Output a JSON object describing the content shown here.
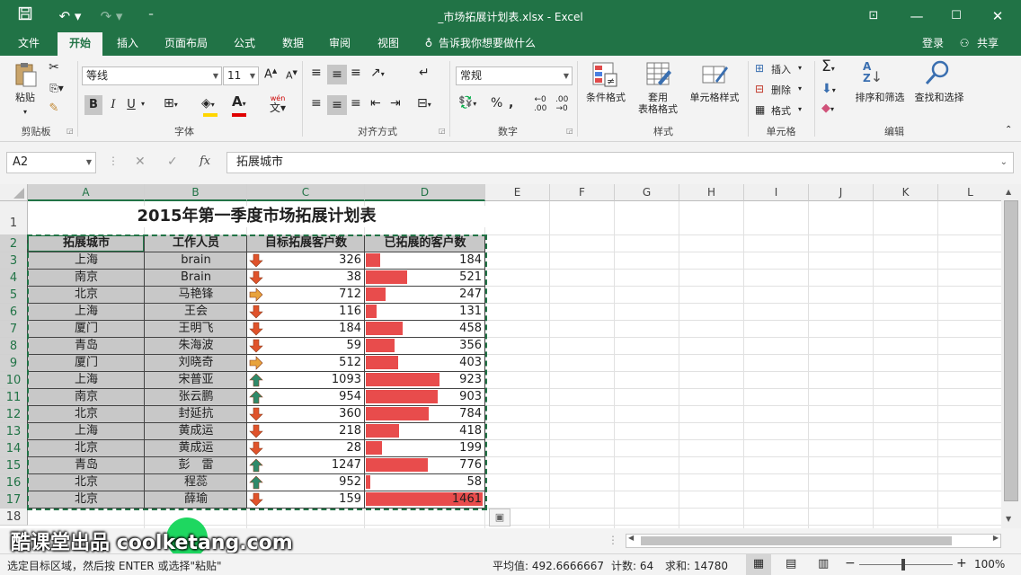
{
  "window": {
    "title": "_市场拓展计划表.xlsx - Excel"
  },
  "quick_access": {
    "save_icon": "save-icon",
    "undo_icon": "undo-icon",
    "redo_icon": "redo-icon",
    "customize_icon": "customize-icon"
  },
  "tabs": [
    "文件",
    "开始",
    "插入",
    "页面布局",
    "公式",
    "数据",
    "审阅",
    "视图"
  ],
  "tell_me": "告诉我你想要做什么",
  "login": "登录",
  "share": "共享",
  "ribbon": {
    "paste": "粘贴",
    "clipboard": "剪贴板",
    "font_name": "等线",
    "font_size": "11",
    "font_group": "字体",
    "align_group": "对齐方式",
    "number_format": "常规",
    "number_group": "数字",
    "cond_format": "条件格式",
    "table_format": "套用\n表格格式",
    "cell_style": "单元格样式",
    "style_group": "样式",
    "insert": "插入",
    "delete": "删除",
    "format": "格式",
    "cells_group": "单元格",
    "sort_filter": "排序和筛选",
    "find_select": "查找和选择",
    "edit_group": "编辑",
    "bold": "B",
    "italic": "I",
    "underline": "U",
    "wen": "wén"
  },
  "formula_bar": {
    "name_box": "A2",
    "fx": "fx",
    "content": "拓展城市"
  },
  "sheet": {
    "columns": [
      "A",
      "B",
      "C",
      "D",
      "E",
      "F",
      "G",
      "H",
      "I",
      "J",
      "K",
      "L"
    ],
    "rows": [
      "1",
      "2",
      "3",
      "4",
      "5",
      "6",
      "7",
      "8",
      "9",
      "10",
      "11",
      "12",
      "13",
      "14",
      "15",
      "16",
      "17",
      "18"
    ],
    "title": "2015年第一季度市场拓展计划表",
    "headers": [
      "拓展城市",
      "工作人员",
      "目标拓展客户数",
      "已拓展的客户数"
    ],
    "data": [
      {
        "city": "上海",
        "staff": "brain",
        "target": 326,
        "done": 184,
        "arrow": "down"
      },
      {
        "city": "南京",
        "staff": "Brain",
        "target": 38,
        "done": 521,
        "arrow": "down"
      },
      {
        "city": "北京",
        "staff": "马艳锋",
        "target": 712,
        "done": 247,
        "arrow": "right"
      },
      {
        "city": "上海",
        "staff": "王会",
        "target": 116,
        "done": 131,
        "arrow": "down"
      },
      {
        "city": "厦门",
        "staff": "王明飞",
        "target": 184,
        "done": 458,
        "arrow": "down"
      },
      {
        "city": "青岛",
        "staff": "朱海波",
        "target": 59,
        "done": 356,
        "arrow": "down"
      },
      {
        "city": "厦门",
        "staff": "刘晓奇",
        "target": 512,
        "done": 403,
        "arrow": "right"
      },
      {
        "city": "上海",
        "staff": "宋普亚",
        "target": 1093,
        "done": 923,
        "arrow": "up"
      },
      {
        "city": "南京",
        "staff": "张云鹏",
        "target": 954,
        "done": 903,
        "arrow": "up"
      },
      {
        "city": "北京",
        "staff": "封延抗",
        "target": 360,
        "done": 784,
        "arrow": "down"
      },
      {
        "city": "上海",
        "staff": "黄成运",
        "target": 218,
        "done": 418,
        "arrow": "down"
      },
      {
        "city": "北京",
        "staff": "黄成运",
        "target": 28,
        "done": 199,
        "arrow": "down"
      },
      {
        "city": "青岛",
        "staff": "彭　雷",
        "target": 1247,
        "done": 776,
        "arrow": "up"
      },
      {
        "city": "北京",
        "staff": "程蕊",
        "target": 952,
        "done": 58,
        "arrow": "up"
      },
      {
        "city": "北京",
        "staff": "薛瑜",
        "target": 159,
        "done": 1461,
        "arrow": "down"
      }
    ],
    "bar_max": 1461
  },
  "colors": {
    "excel_green": "#217346",
    "bar": "#e84c4c",
    "down_arrow": "#e0532b",
    "right_arrow": "#e8a33c",
    "up_arrow": "#2f8a6a",
    "header_gray": "#c8c8c8"
  },
  "watermark": "酷课堂出品 coolketang.com",
  "status": {
    "message": "选定目标区域，然后按 ENTER 或选择\"粘贴\"",
    "average": "平均值: 492.6666667",
    "count": "计数: 64",
    "sum": "求和: 14780",
    "zoom": "100%"
  }
}
